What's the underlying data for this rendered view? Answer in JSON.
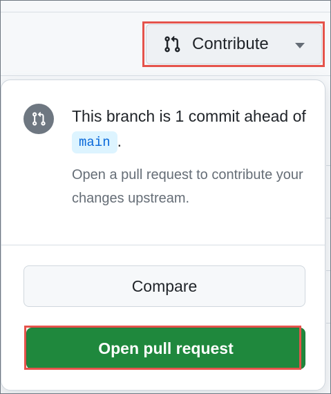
{
  "toolbar": {
    "contribute_label": "Contribute",
    "icon": "git-pull-request-icon",
    "caret": "triangle-down-icon"
  },
  "panel": {
    "headline_prefix": "This branch is 1 commit ahead of",
    "branch_name": "main",
    "headline_suffix": ".",
    "description": "Open a pull request to contribute your changes upstream.",
    "icon": "git-pull-request-icon",
    "compare_label": "Compare",
    "open_pr_label": "Open pull request"
  },
  "colors": {
    "primary_button": "#1f883d",
    "highlight": "#e5534b",
    "branch_pill_bg": "#ddf4ff",
    "branch_pill_text": "#0969da",
    "muted_text": "#656d76"
  }
}
